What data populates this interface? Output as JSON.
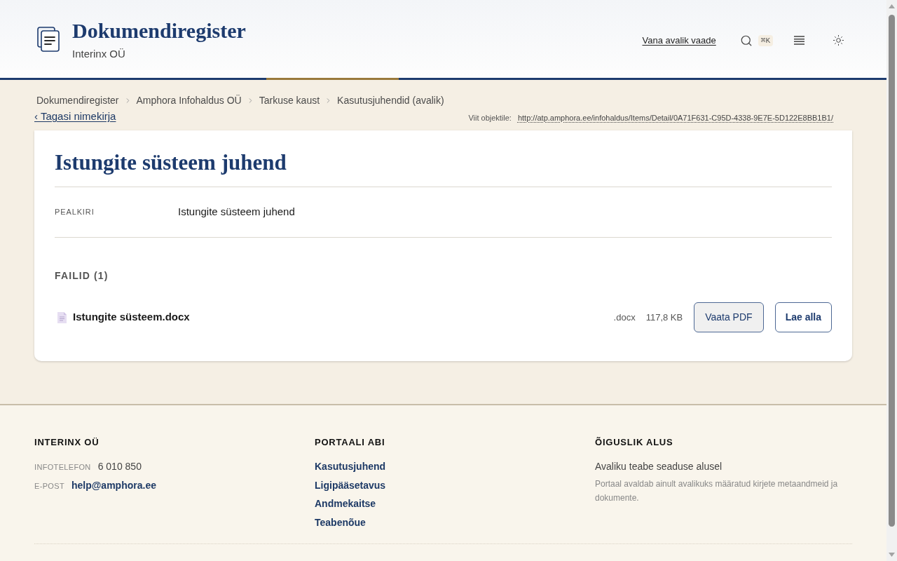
{
  "header": {
    "title": "Dokumendiregister",
    "subtitle": "Interinx OÜ",
    "link": "Vana avalik vaade",
    "shortcut": "⌘K"
  },
  "breadcrumb": [
    {
      "label": "Dokumendiregister"
    },
    {
      "label": "Amphora Infohaldus OÜ"
    },
    {
      "label": "Tarkuse kaust"
    },
    {
      "label": "Kasutusjuhendid (avalik)"
    }
  ],
  "back_link": "‹ Tagasi nimekirja",
  "reference": {
    "label": "Viit objektile:",
    "url": "http://atp.amphora.ee/infohaldus/Items/Detail/0A71F631-C95D-4338-9E7E-5D122E8BB1B1/"
  },
  "document": {
    "title": "Istungite süsteem juhend",
    "fields": [
      {
        "label": "PEALKIRI",
        "value": "Istungite süsteem juhend"
      }
    ],
    "files_heading": "FAILID (1)",
    "files": [
      {
        "name": "Istungite süsteem.docx",
        "extension": ".docx",
        "size": "117,8 KB",
        "actions": [
          {
            "label": "Vaata PDF",
            "kind": "secondary"
          },
          {
            "label": "Lae alla",
            "kind": "primary"
          }
        ]
      }
    ]
  },
  "footer": {
    "columns": [
      {
        "kind": "contacts",
        "heading": "INTERINX OÜ",
        "rows": [
          {
            "label": "INFOTELEFON",
            "value": "6 010 850",
            "kind": "text"
          },
          {
            "label": "E-POST",
            "value": "help@amphora.ee",
            "kind": "link"
          }
        ]
      },
      {
        "kind": "links",
        "heading": "PORTAALI ABI",
        "links": [
          "Kasutusjuhend",
          "Ligipääsetavus",
          "Andmekaitse",
          "Teabenõue"
        ]
      },
      {
        "kind": "text",
        "heading": "ÕIGUSLIK ALUS",
        "lead": "Avaliku teabe seaduse alusel",
        "note": "Portaal avaldab ainult avalikuks määratud kirjete metaandmeid ja dokumente."
      }
    ]
  }
}
